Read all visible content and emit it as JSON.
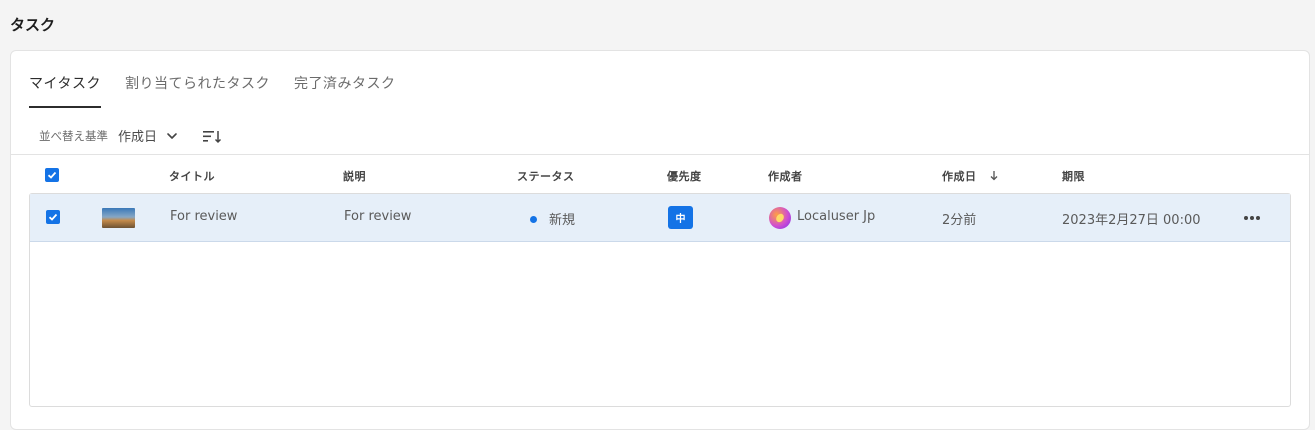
{
  "page": {
    "title": "タスク"
  },
  "tabs": [
    {
      "label": "マイタスク",
      "active": true
    },
    {
      "label": "割り当てられたタスク",
      "active": false
    },
    {
      "label": "完了済みタスク",
      "active": false
    }
  ],
  "sort": {
    "label": "並べ替え基準",
    "value": "作成日",
    "icon_chevron": "chevron-down-icon",
    "icon_order": "sort-order-icon"
  },
  "table": {
    "columns": [
      "タイトル",
      "説明",
      "ステータス",
      "優先度",
      "作成者",
      "作成日",
      "期限"
    ],
    "sorted_column_icon": "arrow-down-icon",
    "rows": [
      {
        "selected": true,
        "title": "For review",
        "description": "For review",
        "status": "新規",
        "priority": "中",
        "creator": "Localuser Jp",
        "created": "2分前",
        "due": "2023年2月27日 00:00"
      }
    ]
  },
  "colors": {
    "accent": "#1473e6",
    "row_selected": "#e6eff9"
  }
}
